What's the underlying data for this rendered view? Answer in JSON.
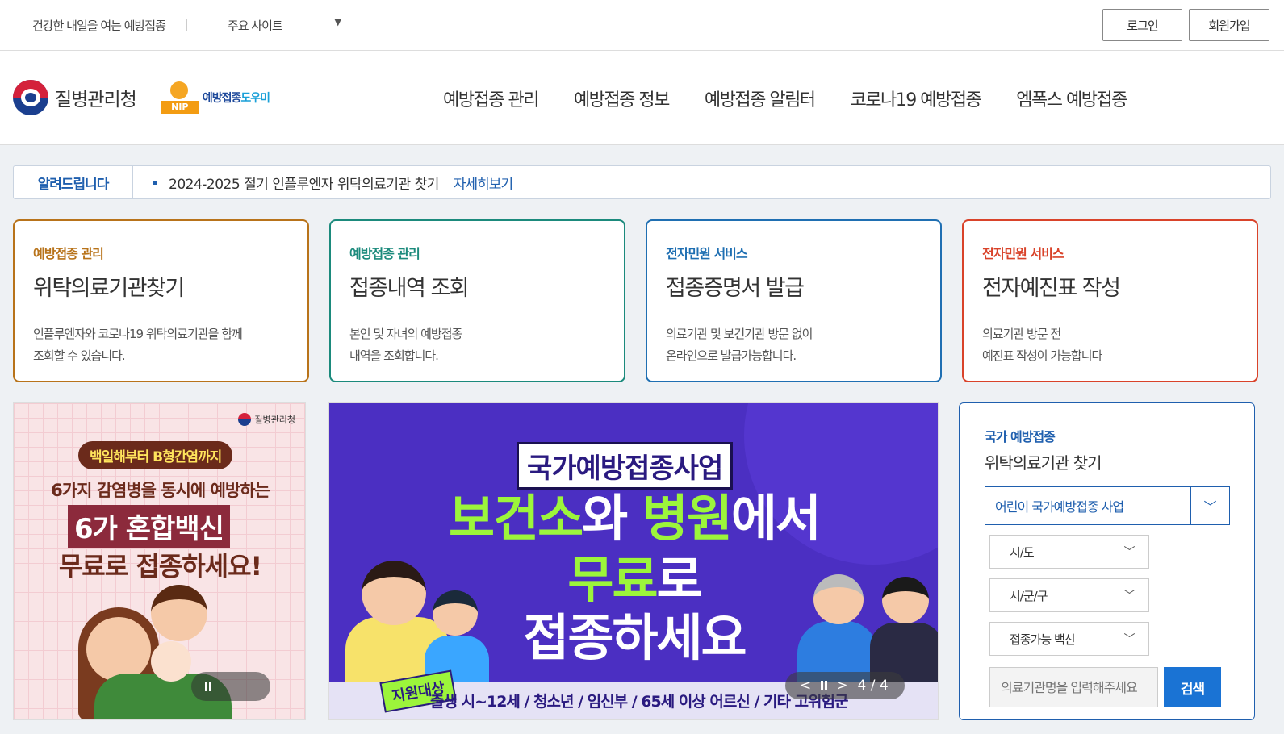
{
  "topbar": {
    "slogan": "건강한 내일을 여는 예방접종",
    "sites_label": "주요 사이트",
    "sites_arrow": "▼",
    "login": "로그인",
    "join": "회원가입"
  },
  "header": {
    "org_name": "질병관리청",
    "nip_name_a": "예방접종",
    "nip_name_b": "도우미",
    "nip_badge": "NIP",
    "nav": [
      "예방접종 관리",
      "예방접종 정보",
      "예방접종 알림터",
      "코로나19 예방접종",
      "엠폭스 예방접종"
    ]
  },
  "notice": {
    "label": "알려드립니다",
    "text": "2024-2025 절기 인플루엔자 위탁의료기관 찾기",
    "link": "자세히보기"
  },
  "cards": [
    {
      "category": "예방접종 관리",
      "title": "위탁의료기관찾기",
      "desc": "인플루엔자와 코로나19 위탁의료기관을 함께\n조회할 수 있습니다."
    },
    {
      "category": "예방접종 관리",
      "title": "접종내역 조회",
      "desc": "본인 및 자녀의 예방접종\n내역을 조회합니다."
    },
    {
      "category": "전자민원 서비스",
      "title": "접종증명서 발급",
      "desc": "의료기관 및 보건기관 방문 없이\n온라인으로 발급가능합니다."
    },
    {
      "category": "전자민원 서비스",
      "title": "전자예진표 작성",
      "desc": "의료기관 방문 전\n예진표 작성이 가능합니다"
    }
  ],
  "banner_left": {
    "org": "질병관리청",
    "pill": "백일해부터 B형간염까지",
    "line2": "6가지 감염병을 동시에 예방하는",
    "line3": "6가 혼합백신",
    "line4": "무료로 접종하세요!"
  },
  "banner_main": {
    "title": "국가예방접종사업",
    "line2_g1": "보건소",
    "line2_w1": "와 ",
    "line2_g2": "병원",
    "line2_w2": "에서",
    "line3_g": "무료",
    "line3_w": "로",
    "line4": "접종하세요",
    "target_label": "지원대상",
    "target_text": "출생 시~12세 / 청소년 / 임신부 / 65세 이상 어르신 / 기타 고위험군",
    "prev": "<",
    "next": ">",
    "counter": "4 / 4"
  },
  "search": {
    "sub": "국가 예방접종",
    "title": "위탁의료기관 찾기",
    "program": "어린이 국가예방접종 사업",
    "sido": "시/도",
    "sigungu": "시/군/구",
    "vaccine": "접종가능 백신",
    "placeholder": "의료기관명을 입력해주세요",
    "button": "검색"
  },
  "colors": {
    "primary": "#1f5fae",
    "card1": "#b8731a",
    "card2": "#1b8a7c",
    "card3": "#1f6fb2",
    "card4": "#d9432a",
    "banner_bg": "#4b2fc2",
    "accent_green": "#9cf53b"
  }
}
